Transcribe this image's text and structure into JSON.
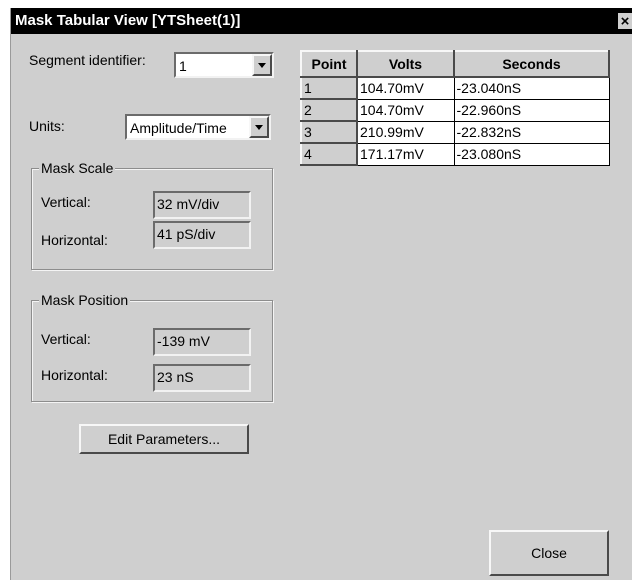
{
  "window": {
    "title": "Mask Tabular View [YTSheet(1)]",
    "close_glyph": "×"
  },
  "segment": {
    "label": "Segment identifier:",
    "value": "1"
  },
  "units": {
    "label": "Units:",
    "value": "Amplitude/Time"
  },
  "mask_scale": {
    "title": "Mask Scale",
    "vertical_label": "Vertical:",
    "vertical_value": "32 mV/div",
    "horizontal_label": "Horizontal:",
    "horizontal_value": "41 pS/div"
  },
  "mask_position": {
    "title": "Mask Position",
    "vertical_label": "Vertical:",
    "vertical_value": "-139 mV",
    "horizontal_label": "Horizontal:",
    "horizontal_value": "23 nS"
  },
  "buttons": {
    "edit_parameters": "Edit Parameters...",
    "close": "Close"
  },
  "table": {
    "headers": [
      "Point",
      "Volts",
      "Seconds"
    ],
    "rows": [
      [
        "1",
        "104.70mV",
        "-23.040nS"
      ],
      [
        "2",
        "104.70mV",
        "-22.960nS"
      ],
      [
        "3",
        "210.99mV",
        "-22.832nS"
      ],
      [
        "4",
        "171.17mV",
        "-23.080nS"
      ]
    ]
  }
}
